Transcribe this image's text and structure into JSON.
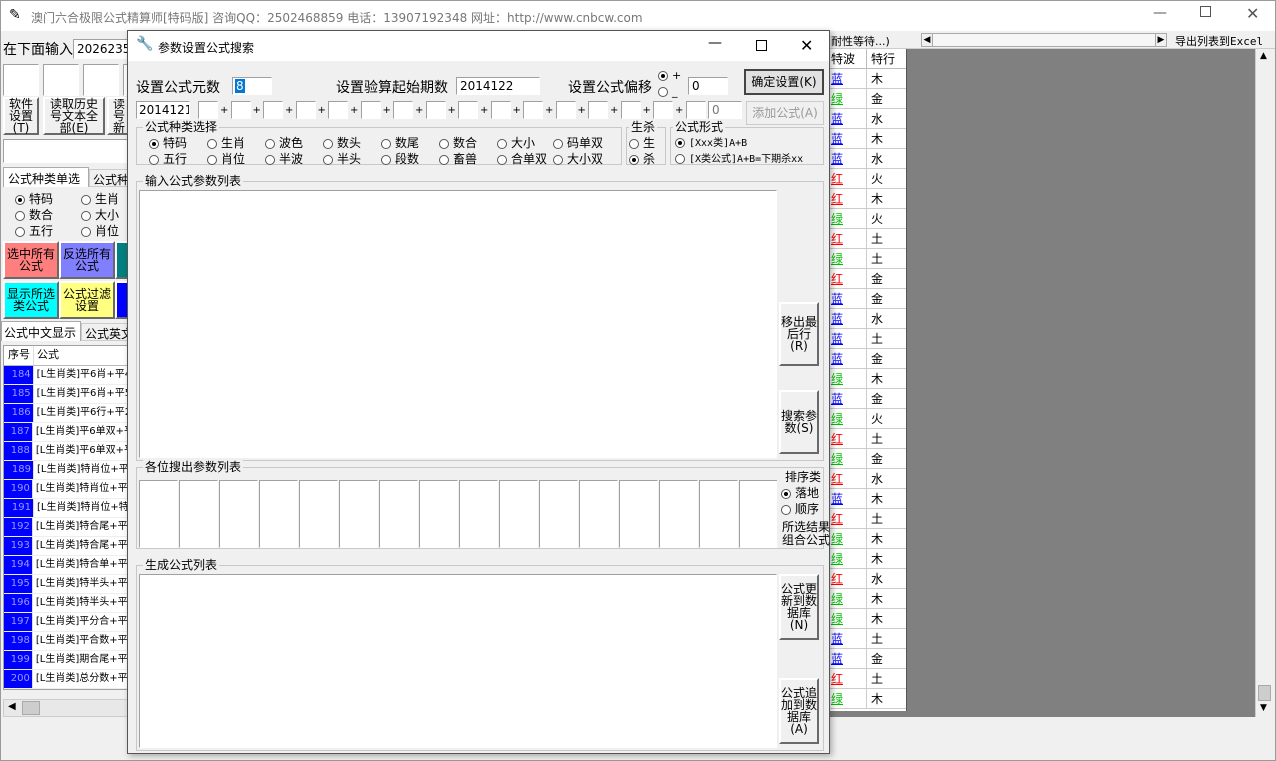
{
  "main_window": {
    "title": "澳门六合极限公式精算师[特码版]  咨询QQ：2502468859 电话：13907192348 网址：http://www.cnbcw.com",
    "input_label": "在下面输入",
    "input_value": "2026235",
    "left_buttons": [
      "软件设置(T)",
      "读取历史号文本全部(E)",
      "读号新"
    ],
    "formula_type_tabs": [
      "公式种类单选",
      "公式种"
    ],
    "type_radios": [
      {
        "label": "特码",
        "selected": true
      },
      {
        "label": "生肖",
        "selected": false
      },
      {
        "label": "数合",
        "selected": false
      },
      {
        "label": "大小",
        "selected": false
      },
      {
        "label": "五行",
        "selected": false
      },
      {
        "label": "肖位",
        "selected": false
      }
    ],
    "color_buttons": [
      {
        "label": "选中所有公式",
        "color": "#ff7f7f"
      },
      {
        "label": "反选所有公式",
        "color": "#7f7fff"
      },
      {
        "label": "显示所选类公式",
        "color": "#00ffff"
      },
      {
        "label": "公式过滤设置",
        "color": "#ffff80"
      }
    ],
    "display_tabs": [
      "公式中文显示",
      "公式英文"
    ],
    "table_headers": [
      "序号",
      "公式"
    ],
    "table_rows": [
      {
        "num": "184",
        "formula": "[L生肖类]平6肖+平4"
      },
      {
        "num": "185",
        "formula": "[L生肖类]平6肖+平5"
      },
      {
        "num": "186",
        "formula": "[L生肖类]平6行+平2"
      },
      {
        "num": "187",
        "formula": "[L生肖类]平6单双+平"
      },
      {
        "num": "188",
        "formula": "[L生肖类]平6单双+平"
      },
      {
        "num": "189",
        "formula": "[L生肖类]特肖位+平"
      },
      {
        "num": "190",
        "formula": "[L生肖类]特肖位+平6"
      },
      {
        "num": "191",
        "formula": "[L生肖类]特肖位+特"
      },
      {
        "num": "192",
        "formula": "[L生肖类]特合尾+平3"
      },
      {
        "num": "193",
        "formula": "[L生肖类]特合尾+平4"
      },
      {
        "num": "194",
        "formula": "[L生肖类]特合单+平1"
      },
      {
        "num": "195",
        "formula": "[L生肖类]特半头+平2"
      },
      {
        "num": "196",
        "formula": "[L生肖类]特半头+平2"
      },
      {
        "num": "197",
        "formula": "[L生肖类]平分合+平3"
      },
      {
        "num": "198",
        "formula": "[L生肖类]平合数+平1"
      },
      {
        "num": "199",
        "formula": "[L生肖类]期合尾+平5"
      },
      {
        "num": "200",
        "formula": "[L生肖类]总分数+平2"
      }
    ],
    "right_header_text": "耐性等待...)",
    "export_label": "导出列表到Excel",
    "right_table_headers": [
      "特波",
      "特行"
    ],
    "right_rows": [
      {
        "bo": "蓝",
        "xing": "木",
        "color": "#0000ff"
      },
      {
        "bo": "绿",
        "xing": "金",
        "color": "#00c000"
      },
      {
        "bo": "蓝",
        "xing": "水",
        "color": "#0000ff"
      },
      {
        "bo": "蓝",
        "xing": "木",
        "color": "#0000ff"
      },
      {
        "bo": "蓝",
        "xing": "水",
        "color": "#0000ff"
      },
      {
        "bo": "红",
        "xing": "火",
        "color": "#ff0000"
      },
      {
        "bo": "红",
        "xing": "木",
        "color": "#ff0000"
      },
      {
        "bo": "绿",
        "xing": "火",
        "color": "#00c000"
      },
      {
        "bo": "红",
        "xing": "土",
        "color": "#ff0000"
      },
      {
        "bo": "绿",
        "xing": "土",
        "color": "#00c000"
      },
      {
        "bo": "红",
        "xing": "金",
        "color": "#ff0000"
      },
      {
        "bo": "蓝",
        "xing": "金",
        "color": "#0000ff"
      },
      {
        "bo": "蓝",
        "xing": "水",
        "color": "#0000ff"
      },
      {
        "bo": "蓝",
        "xing": "土",
        "color": "#0000ff"
      },
      {
        "bo": "蓝",
        "xing": "金",
        "color": "#0000ff"
      },
      {
        "bo": "绿",
        "xing": "木",
        "color": "#00c000"
      },
      {
        "bo": "蓝",
        "xing": "金",
        "color": "#0000ff"
      },
      {
        "bo": "绿",
        "xing": "火",
        "color": "#00c000"
      },
      {
        "bo": "红",
        "xing": "土",
        "color": "#ff0000"
      },
      {
        "bo": "绿",
        "xing": "金",
        "color": "#00c000"
      },
      {
        "bo": "红",
        "xing": "水",
        "color": "#ff0000"
      },
      {
        "bo": "蓝",
        "xing": "木",
        "color": "#0000ff"
      },
      {
        "bo": "红",
        "xing": "土",
        "color": "#ff0000"
      },
      {
        "bo": "绿",
        "xing": "木",
        "color": "#00c000"
      },
      {
        "bo": "绿",
        "xing": "木",
        "color": "#00c000"
      },
      {
        "bo": "红",
        "xing": "水",
        "color": "#ff0000"
      },
      {
        "bo": "绿",
        "xing": "木",
        "color": "#00c000"
      },
      {
        "bo": "绿",
        "xing": "木",
        "color": "#00c000"
      },
      {
        "bo": "蓝",
        "xing": "土",
        "color": "#0000ff"
      },
      {
        "bo": "蓝",
        "xing": "金",
        "color": "#0000ff"
      },
      {
        "bo": "红",
        "xing": "土",
        "color": "#ff0000"
      },
      {
        "bo": "绿",
        "xing": "木",
        "color": "#00c000"
      }
    ]
  },
  "dialog": {
    "title": "参数设置公式搜索",
    "yuanshu_label": "设置公式元数",
    "yuanshu_value": "8",
    "qishu_label": "设置验算起始期数",
    "qishu_value": "2014122",
    "pianyi_label": "设置公式偏移",
    "pianyi_plus": "+",
    "pianyi_minus": "_",
    "pianyi_value": "0",
    "confirm_button": "确定设置(K)",
    "row2_first_value": "2014121",
    "row2_last_value": "0",
    "add_formula_button": "添加公式(A)",
    "type_group_label": "公式种类选择",
    "type_options_row1": [
      "特码",
      "生肖",
      "波色",
      "数头",
      "数尾",
      "数合",
      "大小",
      "码单双"
    ],
    "type_options_row2": [
      "五行",
      "肖位",
      "半波",
      "半头",
      "段数",
      "畜兽",
      "合单双",
      "大小双"
    ],
    "shengsha_label": "生杀",
    "shengsha_options": [
      "生",
      "杀"
    ],
    "form_label": "公式形式",
    "form_options": [
      "[Xxx类]A+B",
      "[X类公式]A+B=下期杀xx"
    ],
    "input_list_label": "输入公式参数列表",
    "move_out_button": "移出最后行(R)",
    "search_button": "搜索参数(S)",
    "result_list_label": "各位搜出参数列表",
    "sort_label": "排序类",
    "sort_options": [
      "落地",
      "顺序"
    ],
    "combine_button": "所选结果组合公式",
    "gen_list_label": "生成公式列表",
    "update_db_button": "公式更新到数据库(N)",
    "append_db_button": "公式追加到数据库(A)"
  }
}
